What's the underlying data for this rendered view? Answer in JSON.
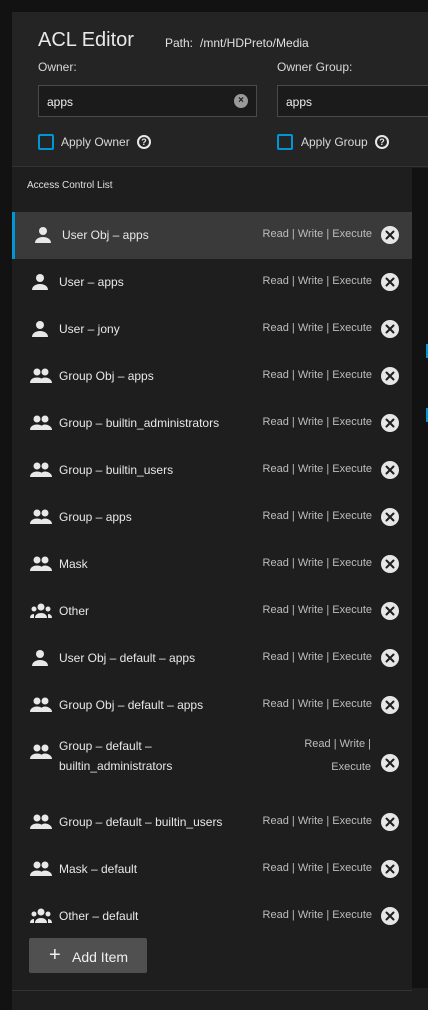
{
  "header": {
    "title": "ACL Editor",
    "path_label": "Path:",
    "path_value": "/mnt/HDPreto/Media",
    "owner_label": "Owner:",
    "owner_value": "apps",
    "owner_group_label": "Owner Group:",
    "owner_group_value": "apps",
    "apply_owner_label": "Apply Owner",
    "apply_group_label": "Apply Group"
  },
  "acl": {
    "title": "Access Control List",
    "items": [
      {
        "label": "User Obj – apps",
        "perm": "Read | Write | Execute",
        "icon": "person-icon"
      },
      {
        "label": "User – apps",
        "perm": "Read | Write | Execute",
        "icon": "person-icon"
      },
      {
        "label": "User – jony",
        "perm": "Read | Write | Execute",
        "icon": "person-icon"
      },
      {
        "label": "Group Obj – apps",
        "perm": "Read | Write | Execute",
        "icon": "group-icon"
      },
      {
        "label": "Group – builtin_administrators",
        "perm": "Read | Write | Execute",
        "icon": "group-icon"
      },
      {
        "label": "Group – builtin_users",
        "perm": "Read | Write | Execute",
        "icon": "group-icon"
      },
      {
        "label": "Group – apps",
        "perm": "Read | Write | Execute",
        "icon": "group-icon"
      },
      {
        "label": "Mask",
        "perm": "Read | Write | Execute",
        "icon": "group-icon"
      },
      {
        "label": "Other",
        "perm": "Read | Write | Execute",
        "icon": "groups-icon"
      },
      {
        "label": "User Obj – default – apps",
        "perm": "Read | Write | Execute",
        "icon": "person-icon"
      },
      {
        "label": "Group Obj – default – apps",
        "perm": "Read | Write | Execute",
        "icon": "group-icon"
      },
      {
        "label_line1": "Group – default –",
        "label_line2": "builtin_administrators",
        "perm_line1": "Read | Write |",
        "perm_line2": "Execute",
        "icon": "group-icon"
      },
      {
        "label": "Group – default – builtin_users",
        "perm": "Read | Write | Execute",
        "icon": "group-icon"
      },
      {
        "label": "Mask – default",
        "perm": "Read | Write | Execute",
        "icon": "group-icon"
      },
      {
        "label": "Other – default",
        "perm": "Read | Write | Execute",
        "icon": "groups-icon"
      }
    ],
    "add_label": "Add Item"
  },
  "colors": {
    "accent": "#0095d5",
    "background": "#1e1e1e"
  }
}
